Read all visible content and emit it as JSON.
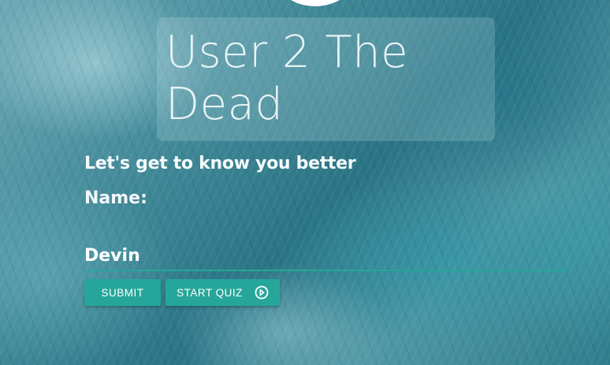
{
  "header": {
    "title": "User 2 The Dead"
  },
  "form": {
    "prompt": "Let's get to know you better",
    "name_label": "Name:",
    "name_value": "Devin"
  },
  "buttons": {
    "submit_label": "SUBMIT",
    "start_quiz_label": "START QUIZ",
    "start_quiz_icon": "play-circle-icon"
  },
  "colors": {
    "accent": "#26a69a",
    "text": "#ffffff"
  }
}
